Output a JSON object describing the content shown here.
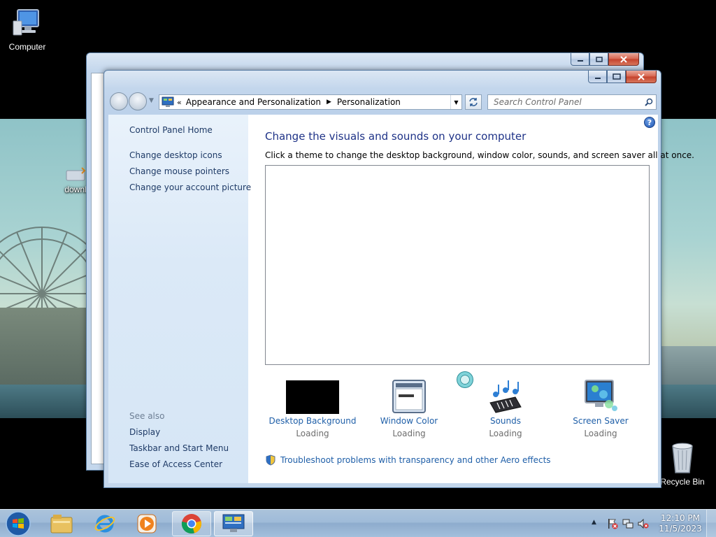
{
  "desktop": {
    "icons": {
      "computer": "Computer",
      "recycle_bin": "Recycle Bin",
      "download_partial": "downl"
    }
  },
  "window": {
    "title": "Personalization",
    "address": {
      "overflow": "«",
      "crumb1": "Appearance and Personalization",
      "crumb2": "Personalization"
    },
    "search": {
      "placeholder": "Search Control Panel"
    },
    "left_pane": {
      "home": "Control Panel Home",
      "links": [
        "Change desktop icons",
        "Change mouse pointers",
        "Change your account picture"
      ],
      "see_also_heading": "See also",
      "see_also": [
        "Display",
        "Taskbar and Start Menu",
        "Ease of Access Center"
      ]
    },
    "main": {
      "heading": "Change the visuals and sounds on your computer",
      "subtext": "Click a theme to change the desktop background, window color, sounds, and screen saver all at once.",
      "tiles": [
        {
          "label": "Desktop Background",
          "status": "Loading",
          "icon": "desktop-background-icon"
        },
        {
          "label": "Window Color",
          "status": "Loading",
          "icon": "window-color-icon"
        },
        {
          "label": "Sounds",
          "status": "Loading",
          "icon": "sounds-icon"
        },
        {
          "label": "Screen Saver",
          "status": "Loading",
          "icon": "screen-saver-icon"
        }
      ],
      "troubleshoot": "Troubleshoot problems with transparency and other Aero effects"
    }
  },
  "taskbar": {
    "pinned": [
      "windows-explorer-icon",
      "internet-explorer-icon",
      "windows-media-player-icon",
      "chrome-icon",
      "control-panel-icon"
    ],
    "clock": {
      "time": "12:10 PM",
      "date": "11/5/2023"
    }
  },
  "colors": {
    "link": "#1f5fa8",
    "heading": "#1e3287",
    "nav_link": "#1e3a66",
    "muted": "#6d6d6d"
  }
}
